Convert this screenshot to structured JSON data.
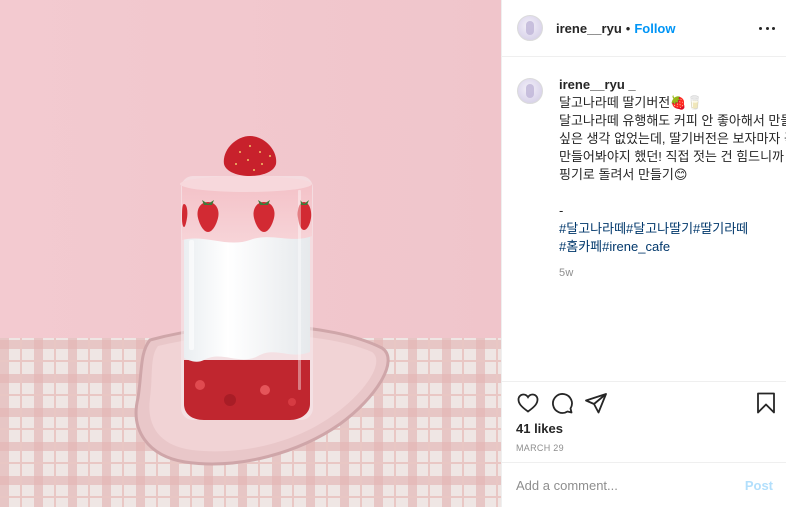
{
  "post": {
    "username": "irene__ryu",
    "header_dot": "•",
    "follow_label": "Follow",
    "more_icon": "more-horizontal-icon"
  },
  "caption": {
    "username": "irene__ryu _",
    "lines": [
      "달고나라떼 딸기버전🍓🥛",
      "달고나라떼 유행해도 커피 안 좋아해서 만들고",
      "싶은 생각 없었는데, 딸기버전은 보자마자 꼭",
      "만들어봐야지 했던! 직접 젓는 건 힘드니까 휘",
      "핑기로 돌려서 만들기😊"
    ],
    "separator": "-",
    "hashtags": [
      "#달고나라떼#달고나딸기#딸기라떼",
      "#홈카페#irene_cafe"
    ],
    "time_ago": "5w"
  },
  "actions": {
    "icons": [
      "heart-icon",
      "comment-icon",
      "share-icon",
      "bookmark-icon"
    ],
    "likes": "41 likes",
    "date": "MARCH 29"
  },
  "comment": {
    "placeholder": "Add a comment...",
    "post_label": "Post"
  },
  "colors": {
    "accent": "#0095f6",
    "post_disabled": "#b2dffc",
    "hashtag": "#00376b",
    "wall": "#f2c9cf"
  }
}
